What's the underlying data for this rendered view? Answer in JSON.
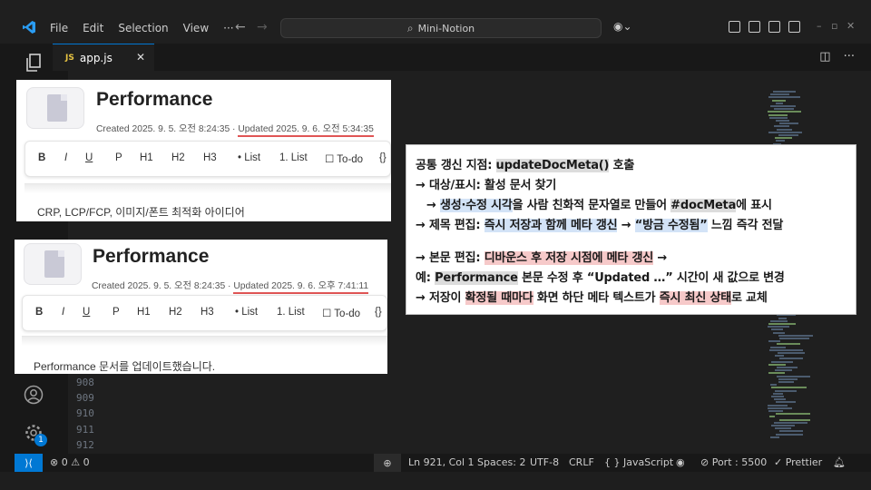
{
  "menu": [
    "File",
    "Edit",
    "Selection",
    "View",
    "···"
  ],
  "search": {
    "label": "Mini-Notion"
  },
  "tab": {
    "file_badge": "JS",
    "label": "app.js",
    "close": "✕"
  },
  "line_numbers": [
    "908",
    "909",
    "910",
    "911",
    "912"
  ],
  "badge_count": "1",
  "panel1": {
    "title": "Performance",
    "created": "Created 2025. 9. 5. 오전 8:24:35 · ",
    "updated": "Updated 2025. 9. 6. 오전 5:34:35",
    "toolbar": [
      "B",
      "I",
      "U",
      "P",
      "H1",
      "H2",
      "H3",
      "• List",
      "1. List",
      "☐ To-do",
      "{}"
    ],
    "body": "CRP, LCP/FCP, 이미지/폰트 최적화 아이디어"
  },
  "panel2": {
    "title": "Performance",
    "created": "Created 2025. 9. 5. 오전 8:24:35 · ",
    "updated": "Updated 2025. 9. 6. 오후 7:41:11",
    "toolbar": [
      "B",
      "I",
      "U",
      "P",
      "H1",
      "H2",
      "H3",
      "• List",
      "1. List",
      "☐ To-do",
      "{}"
    ],
    "body": "Performance 문서를 업데이트했습니다."
  },
  "callout": {
    "l1a": "공통 갱신 지점: ",
    "l1b": "updateDocMeta()",
    "l1c": " 호출",
    "l2": "→ 대상/표시: 활성 문서 찾기",
    "l3a": "→ ",
    "l3b": "생성·수정 시각",
    "l3c": "을 사람 친화적 문자열로 만들어 ",
    "l3d": "#docMeta",
    "l3e": "에 표시",
    "l4a": "→ 제목 편집: ",
    "l4b": "즉시 저장과 함께 메타 갱신",
    "l4c": " → ",
    "l4d": "“방금 수정됨”",
    "l4e": " 느낌 즉각 전달",
    "l5a": "→ 본문 편집: ",
    "l5b": "디바운스 후 저장 시점에 메타 갱신",
    "l5c": " →",
    "l6a": "예: ",
    "l6b": "Performance",
    "l6c": " 본문 수정 후 “Updated …” 시간이 새 값으로 변경",
    "l7a": "→ 저장이 ",
    "l7b": "확정될 때마다",
    "l7c": " 화면 하단 메타 텍스트가 ",
    "l7d": "즉시 최신 상태",
    "l7e": "로 교체"
  },
  "status": {
    "errors": "⊗ 0 ⚠ 0",
    "position": "Ln 921, Col 1",
    "spaces": "Spaces: 2",
    "encoding": "UTF-8",
    "eol": "CRLF",
    "language": "{ }  JavaScript",
    "port": "⊘ Port : 5500",
    "prettier": "✓ Prettier"
  }
}
